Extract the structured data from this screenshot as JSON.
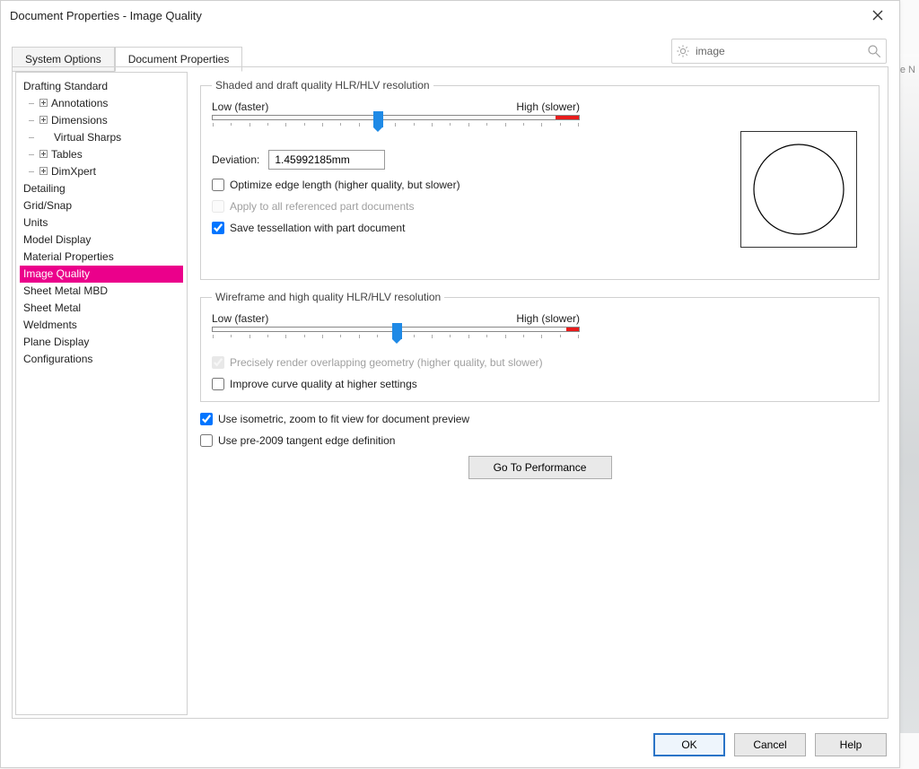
{
  "window_title": "Document Properties - Image Quality",
  "search": {
    "value": "image"
  },
  "tabs": {
    "system_options": "System Options",
    "document_properties": "Document Properties"
  },
  "tree": {
    "drafting_standard": "Drafting Standard",
    "annotations": "Annotations",
    "dimensions": "Dimensions",
    "virtual_sharps": "Virtual Sharps",
    "tables": "Tables",
    "dimxpert": "DimXpert",
    "detailing": "Detailing",
    "grid_snap": "Grid/Snap",
    "units": "Units",
    "model_display": "Model Display",
    "material_properties": "Material Properties",
    "image_quality": "Image Quality",
    "sheet_metal_mbd": "Sheet Metal MBD",
    "sheet_metal": "Sheet Metal",
    "weldments": "Weldments",
    "plane_display": "Plane Display",
    "configurations": "Configurations"
  },
  "group1": {
    "legend": "Shaded and draft quality HLR/HLV resolution",
    "low_label": "Low (faster)",
    "high_label": "High (slower)",
    "deviation_label": "Deviation:",
    "deviation_value": "1.45992185mm",
    "optimize_edge_label": "Optimize edge length (higher quality, but slower)",
    "apply_all_label": "Apply to all referenced part documents",
    "save_tess_label": "Save tessellation with part document"
  },
  "group2": {
    "legend": "Wireframe and high quality HLR/HLV resolution",
    "low_label": "Low (faster)",
    "high_label": "High (slower)",
    "precisely_label": "Precisely render overlapping geometry (higher quality, but slower)",
    "improve_label": "Improve curve quality at higher settings"
  },
  "freestanding": {
    "isometric_label": "Use isometric, zoom to fit view for document preview",
    "pre2009_label": "Use pre-2009 tangent edge definition",
    "perf_button": "Go To Performance"
  },
  "buttons": {
    "ok": "OK",
    "cancel": "Cancel",
    "help": "Help"
  },
  "bg_hints": {
    "ve": "ve  N",
    "e": "e"
  }
}
